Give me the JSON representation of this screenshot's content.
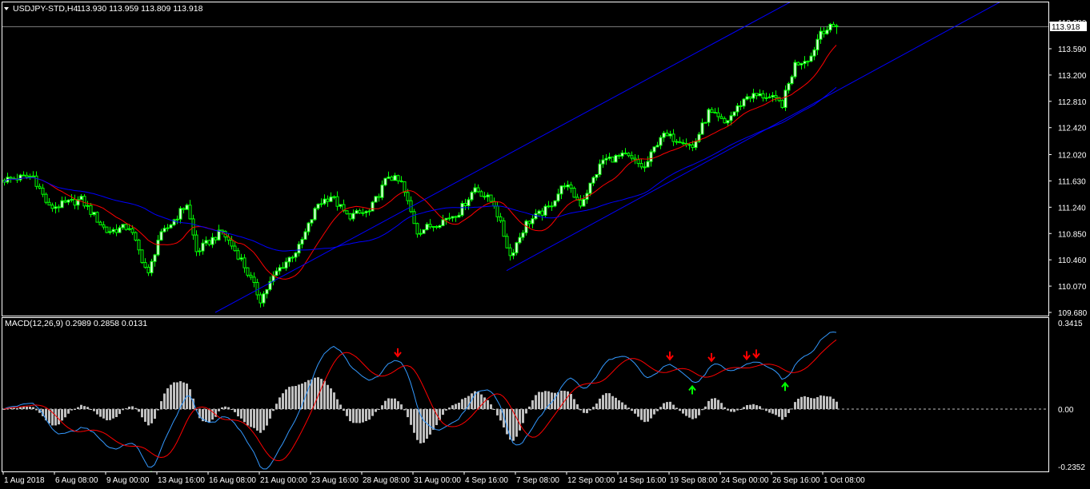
{
  "header": {
    "symbol": "USDJPY-STD,H4",
    "ohlc": "113.930 113.959 113.809 113.918"
  },
  "macd_header": {
    "label": "MACD(12,26,9) 0.2989 0.2858 0.0131"
  },
  "current_price_label": "113.918",
  "colors": {
    "background": "#000000",
    "candle": "#00ff00",
    "bull_body": "#e8ffe8",
    "bear_body": "#000000",
    "fast_ma": "#ff0000",
    "slow_ma": "#0000ff",
    "trendline": "#0000ff",
    "macd_main": "#3399ff",
    "macd_signal": "#ff0000",
    "histogram": "#c0c0c0",
    "arrow_up": "#00ff00",
    "arrow_down": "#ff0000",
    "axis": "#ffffff",
    "price_line": "#808080"
  },
  "chart_data": [
    {
      "type": "candlestick",
      "title": "USDJPY-STD,H4",
      "y_ticks": [
        "113.980",
        "113.590",
        "113.200",
        "112.810",
        "112.420",
        "112.020",
        "111.630",
        "111.240",
        "110.850",
        "110.460",
        "110.070",
        "109.680"
      ],
      "ylim": [
        109.68,
        113.98
      ],
      "x_tick_labels": [
        {
          "index": 0,
          "label": "1 Aug 2018"
        },
        {
          "index": 16,
          "label": "6 Aug 08:00"
        },
        {
          "index": 32,
          "label": "9 Aug 00:00"
        },
        {
          "index": 48,
          "label": "13 Aug 16:00"
        },
        {
          "index": 64,
          "label": "16 Aug 08:00"
        },
        {
          "index": 80,
          "label": "21 Aug 00:00"
        },
        {
          "index": 96,
          "label": "23 Aug 16:00"
        },
        {
          "index": 112,
          "label": "28 Aug 08:00"
        },
        {
          "index": 128,
          "label": "31 Aug 00:00"
        },
        {
          "index": 144,
          "label": "4 Sep 16:00"
        },
        {
          "index": 160,
          "label": "7 Sep 08:00"
        },
        {
          "index": 176,
          "label": "12 Sep 00:00"
        },
        {
          "index": 192,
          "label": "14 Sep 16:00"
        },
        {
          "index": 208,
          "label": "19 Sep 08:00"
        },
        {
          "index": 224,
          "label": "24 Sep 00:00"
        },
        {
          "index": 240,
          "label": "26 Sep 16:00"
        },
        {
          "index": 256,
          "label": "1 Oct 08:00"
        }
      ],
      "candle_count": 261,
      "close_keypoints": [
        [
          0,
          111.65
        ],
        [
          9,
          111.7
        ],
        [
          14,
          111.23
        ],
        [
          24,
          111.35
        ],
        [
          32,
          110.88
        ],
        [
          39,
          110.95
        ],
        [
          45,
          110.23
        ],
        [
          48,
          110.76
        ],
        [
          57,
          111.29
        ],
        [
          60,
          110.58
        ],
        [
          68,
          110.88
        ],
        [
          74,
          110.46
        ],
        [
          80,
          109.87
        ],
        [
          85,
          110.28
        ],
        [
          92,
          110.64
        ],
        [
          98,
          111.29
        ],
        [
          102,
          111.41
        ],
        [
          107,
          111.11
        ],
        [
          114,
          111.17
        ],
        [
          120,
          111.71
        ],
        [
          124,
          111.59
        ],
        [
          129,
          110.88
        ],
        [
          135,
          111.0
        ],
        [
          142,
          111.17
        ],
        [
          147,
          111.53
        ],
        [
          153,
          111.29
        ],
        [
          158,
          110.52
        ],
        [
          163,
          111.0
        ],
        [
          170,
          111.23
        ],
        [
          175,
          111.59
        ],
        [
          180,
          111.29
        ],
        [
          187,
          111.94
        ],
        [
          194,
          112.0
        ],
        [
          200,
          111.82
        ],
        [
          205,
          112.3
        ],
        [
          212,
          112.24
        ],
        [
          215,
          112.12
        ],
        [
          220,
          112.65
        ],
        [
          225,
          112.48
        ],
        [
          232,
          112.89
        ],
        [
          238,
          112.89
        ],
        [
          243,
          112.77
        ],
        [
          247,
          113.36
        ],
        [
          252,
          113.48
        ],
        [
          255,
          113.86
        ],
        [
          260,
          113.918
        ]
      ],
      "last_candle": {
        "open": 113.93,
        "high": 113.959,
        "low": 113.809,
        "close": 113.918
      },
      "current_price": 113.918,
      "moving_averages": [
        {
          "name": "fast MA",
          "period": 14,
          "color": "#ff0000"
        },
        {
          "name": "slow MA",
          "period": 45,
          "color": "#0000ff"
        }
      ],
      "trendlines": [
        {
          "start": [
            66,
            109.68
          ],
          "end": [
            245.5,
            114.28
          ]
        },
        {
          "start": [
            157,
            110.3
          ],
          "end": [
            311,
            114.28
          ]
        }
      ]
    },
    {
      "type": "macd",
      "title": "MACD(12,26,9)",
      "params": [
        12,
        26,
        9
      ],
      "values": {
        "main": 0.2989,
        "signal": 0.2858,
        "histogram": 0.0131
      },
      "y_ticks": [
        "0.3415",
        "0.00",
        "-0.2352"
      ],
      "ylim": [
        -0.2352,
        0.3415
      ],
      "signals_down": [
        123,
        208,
        221,
        232,
        235
      ],
      "signals_up": [
        46,
        215,
        244
      ]
    }
  ]
}
